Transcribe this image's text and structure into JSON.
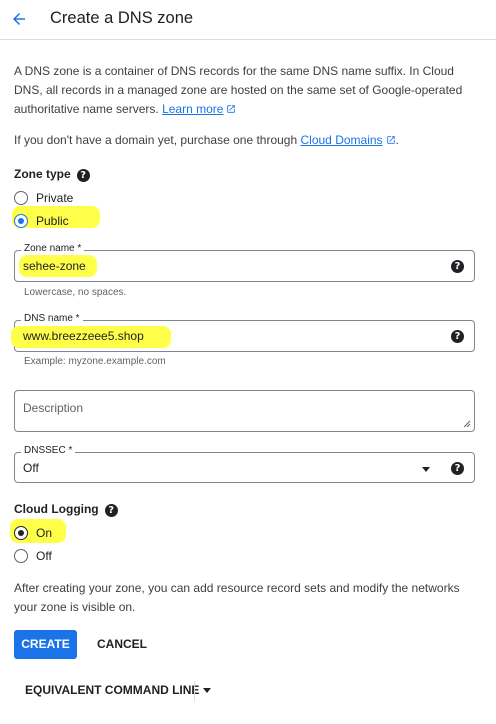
{
  "header": {
    "title": "Create a DNS zone",
    "back_icon": "arrow-back-icon"
  },
  "intro": {
    "text": "A DNS zone is a container of DNS records for the same DNS name suffix. In Cloud DNS, all records in a managed zone are hosted on the same set of Google-operated authoritative name servers.",
    "learn_more": "Learn more"
  },
  "domain_note": {
    "text": "If you don't have a domain yet, purchase one through",
    "link": "Cloud Domains",
    "suffix": "."
  },
  "zone_type": {
    "label": "Zone type",
    "options": [
      "Private",
      "Public"
    ],
    "selected": "Public"
  },
  "zone_name": {
    "label": "Zone name *",
    "value": "sehee-zone",
    "hint": "Lowercase, no spaces."
  },
  "dns_name": {
    "label": "DNS name *",
    "value": "www.breezzeee5.shop",
    "hint": "Example: myzone.example.com"
  },
  "description": {
    "placeholder": "Description"
  },
  "dnssec": {
    "label": "DNSSEC *",
    "value": "Off"
  },
  "cloud_logging": {
    "label": "Cloud Logging",
    "options": [
      "On",
      "Off"
    ],
    "selected": "On"
  },
  "footer_note": "After creating your zone, you can add resource record sets and modify the networks your zone is visible on.",
  "buttons": {
    "create": "CREATE",
    "cancel": "CANCEL",
    "equivalent": "EQUIVALENT COMMAND LINE"
  },
  "colors": {
    "accent": "#1a73e8",
    "highlight": "#ffff4a"
  }
}
